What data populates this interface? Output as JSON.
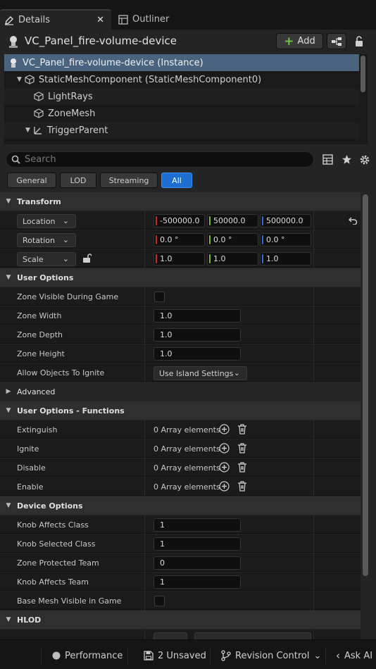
{
  "tabs": {
    "details": "Details",
    "outliner": "Outliner"
  },
  "header": {
    "actor_name": "VC_Panel_fire-volume-device",
    "add_label": "Add"
  },
  "tree": [
    "VC_Panel_fire-volume-device (Instance)",
    "StaticMeshComponent (StaticMeshComponent0)",
    "LightRays",
    "ZoneMesh",
    "TriggerParent"
  ],
  "search": {
    "placeholder": "Search"
  },
  "filters": [
    "General",
    "LOD",
    "Streaming",
    "All"
  ],
  "transform": {
    "category": "Transform",
    "location_label": "Location",
    "location": [
      "-500000.0",
      "50000.0",
      "500000.0"
    ],
    "rotation_label": "Rotation",
    "rotation": [
      "0.0 °",
      "0.0 °",
      "0.0 °"
    ],
    "scale_label": "Scale",
    "scale": [
      "1.0",
      "1.0",
      "1.0"
    ]
  },
  "user_options": {
    "category": "User Options",
    "zone_visible_label": "Zone Visible During Game",
    "zone_width_label": "Zone Width",
    "zone_width": "1.0",
    "zone_depth_label": "Zone Depth",
    "zone_depth": "1.0",
    "zone_height_label": "Zone Height",
    "zone_height": "1.0",
    "allow_ignite_label": "Allow Objects To Ignite",
    "allow_ignite": "Use Island Settings"
  },
  "advanced": "Advanced",
  "functions": {
    "category": "User Options - Functions",
    "rows": [
      {
        "label": "Extinguish",
        "value": "0 Array elements"
      },
      {
        "label": "Ignite",
        "value": "0 Array elements"
      },
      {
        "label": "Disable",
        "value": "0 Array elements"
      },
      {
        "label": "Enable",
        "value": "0 Array elements"
      }
    ]
  },
  "device_options": {
    "category": "Device Options",
    "rows": [
      {
        "label": "Knob Affects Class",
        "value": "1"
      },
      {
        "label": "Knob Selected Class",
        "value": "1"
      },
      {
        "label": "Zone Protected Team",
        "value": "0"
      },
      {
        "label": "Knob Affects Team",
        "value": "1"
      }
    ],
    "base_mesh_label": "Base Mesh Visible in Game"
  },
  "hlod": "HLOD",
  "status": {
    "performance": "Performance",
    "unsaved": "2 Unsaved",
    "revision": "Revision Control",
    "ask_ai": "Ask AI"
  },
  "colors": {
    "accent": "#1c6ed3",
    "selected_row": "#4a6480",
    "add_plus": "#6fc13f"
  }
}
